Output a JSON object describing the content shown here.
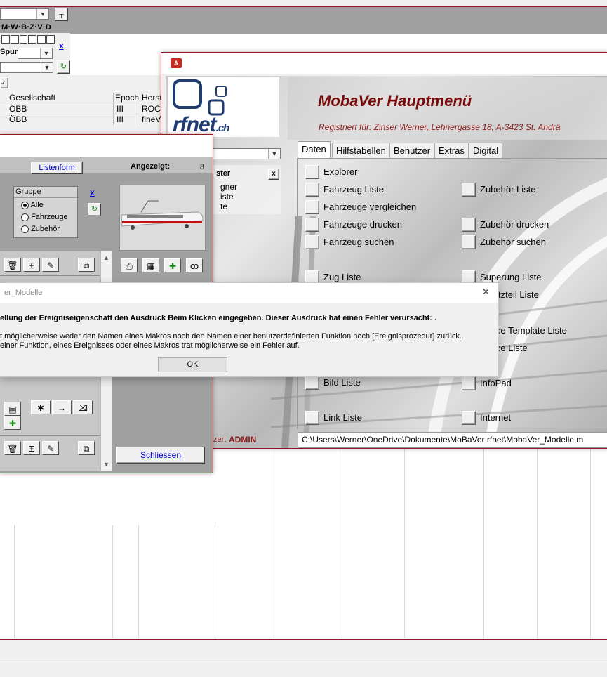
{
  "background_app": {
    "filter_label": "M·W·B·Z·V·D",
    "spur_label": "Spur:",
    "grid": {
      "columns": [
        "Gesellschaft",
        "Epoch",
        "Herst"
      ],
      "rows": [
        [
          "ÖBB",
          "III",
          "ROCO"
        ],
        [
          "ÖBB",
          "III",
          "fineV"
        ]
      ]
    },
    "close_x": "x"
  },
  "list_window": {
    "listenform_button": "Listenform",
    "angezeigt_label": "Angezeigt:",
    "angezeigt_value": "8",
    "gruppe_label": "Gruppe",
    "gruppe_options": [
      "Alle",
      "Fahrzeuge",
      "Zubehör"
    ],
    "close_x": "x",
    "schliessen_button": "Schliessen"
  },
  "main_menu": {
    "title": "MobaVer Hauptmenü",
    "registered": "Registriert für: Zinser Werner, Lehnergasse 18, A-3423 St. Andrä",
    "logo_text": "rfnet",
    "logo_suffix": ".ch",
    "sub_list_title": "ster",
    "sub_list_close": "x",
    "sub_list_items": [
      "gner",
      "iste",
      "te"
    ],
    "tabs": [
      "Daten",
      "Hilfstabellen",
      "Benutzer",
      "Extras",
      "Digital"
    ],
    "left_items": [
      "Explorer",
      "Fahrzeug Liste",
      "Fahrzeuge vergleichen",
      "Fahrzeuge drucken",
      "Fahrzeug suchen",
      "Zug Liste",
      "Bild Liste",
      "Link Liste"
    ],
    "right_items": [
      "Zubehör Liste",
      "Zubehör drucken",
      "Zubehör suchen",
      "Superung Liste",
      "tzteil Liste",
      "ice Template Liste",
      "ice Liste",
      "InfoPad",
      "Internet"
    ],
    "user_label": "zer:",
    "user_value": "ADMIN",
    "path": "C:\\Users\\Werner\\OneDrive\\Dokumente\\MoBaVer rfnet\\MobaVer_Modelle.m"
  },
  "dialog": {
    "title": "er_Modelle",
    "line_bold": "ellung der Ereigniseigenschaft den Ausdruck Beim Klicken eingegeben. Dieser Ausdruck hat einen Fehler verursacht: .",
    "line2": "t möglicherweise weder den Namen eines Makros noch den Namen einer benutzerdefinierten Funktion noch [Ereignisprozedur] zurück.",
    "line3": "einer Funktion, eines Ereignisses oder eines Makros trat möglicherweise ein Fehler auf.",
    "ok_button": "OK",
    "close_glyph": "✕"
  },
  "colors": {
    "accent_red": "#8b1a1a",
    "title_red": "#7a0a0a",
    "panel_gray": "#a0a0a0",
    "link_blue": "#0000cc"
  }
}
